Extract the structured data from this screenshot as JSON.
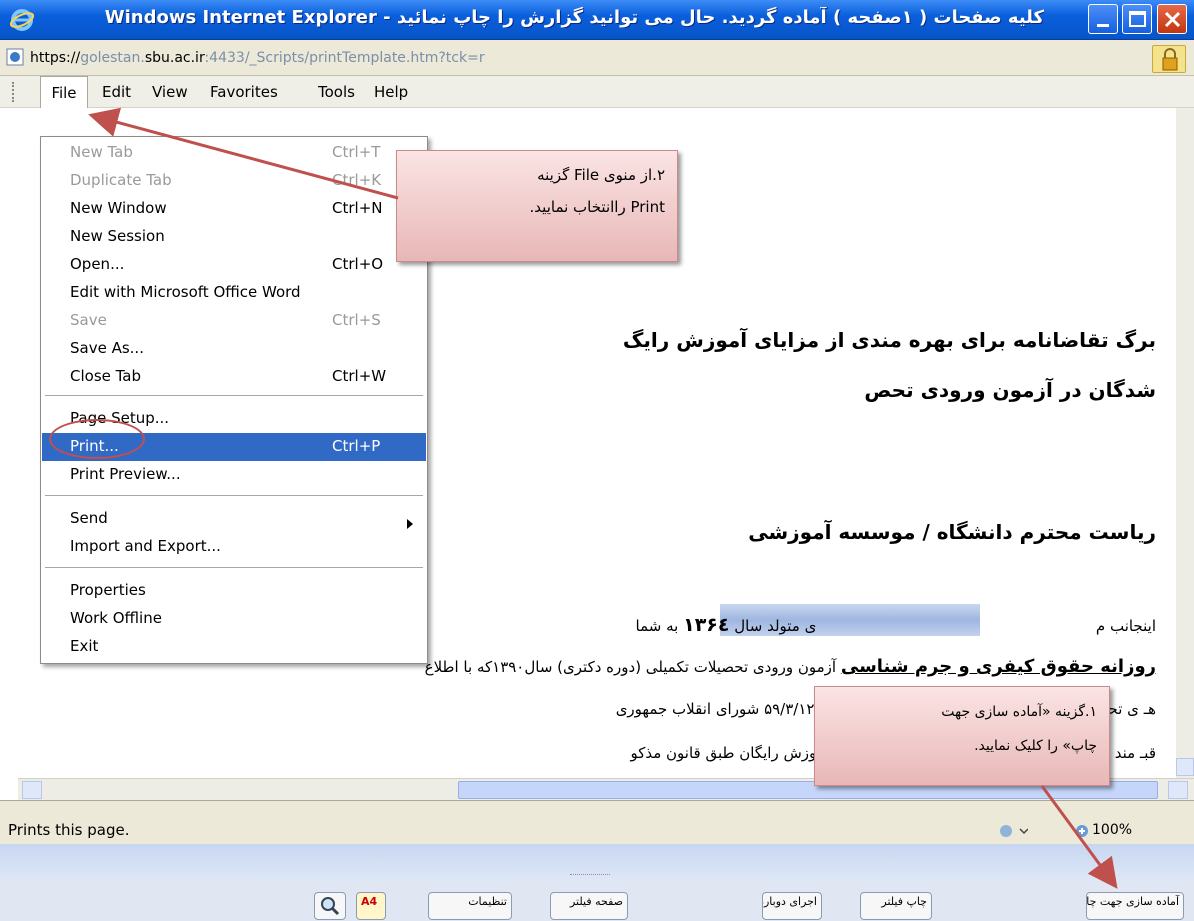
{
  "window": {
    "title": "کلیه صفحات ( ۱صفحه ) آماده گردید. حال می توانید گزارش را چاپ نمائید - Windows Internet Explorer"
  },
  "address_bar": {
    "scheme": "https://",
    "host_prefix": "golestan.",
    "host_main": "sbu.ac.ir",
    "path": ":4433/_Scripts/printTemplate.htm?tck=r"
  },
  "menubar": {
    "items": [
      "File",
      "Edit",
      "View",
      "Favorites",
      "Tools",
      "Help"
    ]
  },
  "file_menu": {
    "items": [
      {
        "label": "New Tab",
        "shortcut": "Ctrl+T",
        "disabled": true
      },
      {
        "label": "Duplicate Tab",
        "shortcut": "Ctrl+K",
        "disabled": true
      },
      {
        "label": "New Window",
        "shortcut": "Ctrl+N"
      },
      {
        "label": "New Session",
        "shortcut": ""
      },
      {
        "label": "Open...",
        "shortcut": "Ctrl+O"
      },
      {
        "label": "Edit with Microsoft Office Word",
        "shortcut": ""
      },
      {
        "label": "Save",
        "shortcut": "Ctrl+S",
        "disabled": true
      },
      {
        "label": "Save As...",
        "shortcut": ""
      },
      {
        "label": "Close Tab",
        "shortcut": "Ctrl+W"
      },
      {
        "label": "Page Setup...",
        "shortcut": ""
      },
      {
        "label": "Print...",
        "shortcut": "Ctrl+P",
        "selected": true
      },
      {
        "label": "Print Preview...",
        "shortcut": ""
      },
      {
        "label": "Send",
        "shortcut": ""
      },
      {
        "label": "Import and Export...",
        "shortcut": ""
      },
      {
        "label": "Properties",
        "shortcut": ""
      },
      {
        "label": "Work Offline",
        "shortcut": ""
      },
      {
        "label": "Exit",
        "shortcut": ""
      }
    ]
  },
  "document": {
    "title_line_1": "برگ تقاضانامه برای بهره مندی از مزایای آموزش رایگ",
    "title_line_2": "شدگان در آزمون ورودی تحص",
    "salutation": "ریاست محترم دانشگاه / موسسه آموزشی",
    "line_1_a": "اینجانب م",
    "line_1_b": "ی متولد سال",
    "line_1_year": "۱۳۶٤",
    "line_1_c": "به شما",
    "line_2_bold": "روزانه حقوق کیفری و جرم شناسی",
    "line_2": "آزمون ورودی تحصیلات تکمیلی (دوره دکتری) سال۱۳۹۰که با اطلاع",
    "line_3": "هـ          ی تحصیل اطفال و جوانان ایرانی که در جلسه مورخ ۵۹/۳/۱۲ شورای انقلاب جمهوری",
    "line_4": "قبـ          مند هستم در طول تحصیل دوره دکتری از مزایای آموزش رایگان طبق قانون مذکو"
  },
  "callouts": {
    "step2_line1": "۲.از منوی File گزینه",
    "step2_line2": "Print راانتخاب نمایید.",
    "step1_line1": "۱.گزینه «آماده سازی جهت",
    "step1_line2": "چاپ» را کلیک نمایید."
  },
  "statusbar": {
    "text": "Prints this page.",
    "zoom": "100%"
  },
  "app_toolbar": {
    "prepare_print": "آماده سازی جهت چاپ",
    "print_filter": "چاپ فیلتر",
    "rerun": "اجرای دوباره",
    "page_filter": "صفحه فیلتر",
    "settings": "تنظیمات",
    "a4": "A4"
  },
  "colors": {
    "titlebar": "#0a5fdc",
    "menu_selected": "#316ac5",
    "annotation": "#c0504d"
  }
}
